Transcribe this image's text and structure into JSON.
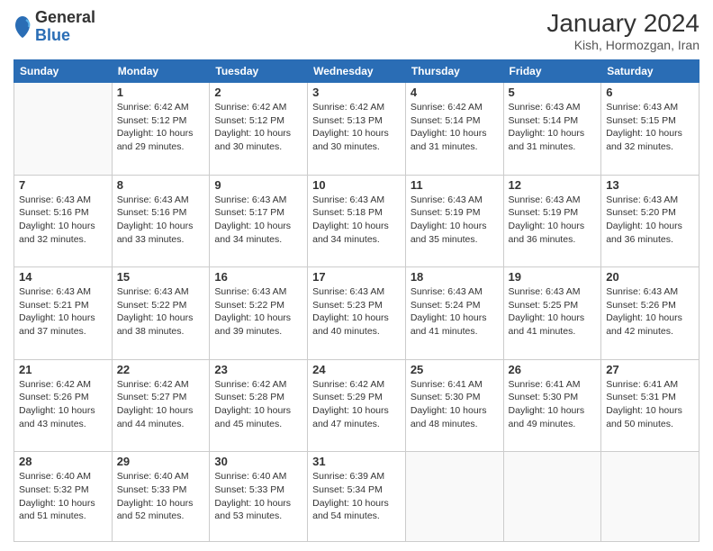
{
  "header": {
    "logo": {
      "general": "General",
      "blue": "Blue"
    },
    "title": "January 2024",
    "location": "Kish, Hormozgan, Iran"
  },
  "days_of_week": [
    "Sunday",
    "Monday",
    "Tuesday",
    "Wednesday",
    "Thursday",
    "Friday",
    "Saturday"
  ],
  "weeks": [
    [
      {
        "day": "",
        "info": ""
      },
      {
        "day": "1",
        "info": "Sunrise: 6:42 AM\nSunset: 5:12 PM\nDaylight: 10 hours and 29 minutes."
      },
      {
        "day": "2",
        "info": "Sunrise: 6:42 AM\nSunset: 5:12 PM\nDaylight: 10 hours and 30 minutes."
      },
      {
        "day": "3",
        "info": "Sunrise: 6:42 AM\nSunset: 5:13 PM\nDaylight: 10 hours and 30 minutes."
      },
      {
        "day": "4",
        "info": "Sunrise: 6:42 AM\nSunset: 5:14 PM\nDaylight: 10 hours and 31 minutes."
      },
      {
        "day": "5",
        "info": "Sunrise: 6:43 AM\nSunset: 5:14 PM\nDaylight: 10 hours and 31 minutes."
      },
      {
        "day": "6",
        "info": "Sunrise: 6:43 AM\nSunset: 5:15 PM\nDaylight: 10 hours and 32 minutes."
      }
    ],
    [
      {
        "day": "7",
        "info": "Sunrise: 6:43 AM\nSunset: 5:16 PM\nDaylight: 10 hours and 32 minutes."
      },
      {
        "day": "8",
        "info": "Sunrise: 6:43 AM\nSunset: 5:16 PM\nDaylight: 10 hours and 33 minutes."
      },
      {
        "day": "9",
        "info": "Sunrise: 6:43 AM\nSunset: 5:17 PM\nDaylight: 10 hours and 34 minutes."
      },
      {
        "day": "10",
        "info": "Sunrise: 6:43 AM\nSunset: 5:18 PM\nDaylight: 10 hours and 34 minutes."
      },
      {
        "day": "11",
        "info": "Sunrise: 6:43 AM\nSunset: 5:19 PM\nDaylight: 10 hours and 35 minutes."
      },
      {
        "day": "12",
        "info": "Sunrise: 6:43 AM\nSunset: 5:19 PM\nDaylight: 10 hours and 36 minutes."
      },
      {
        "day": "13",
        "info": "Sunrise: 6:43 AM\nSunset: 5:20 PM\nDaylight: 10 hours and 36 minutes."
      }
    ],
    [
      {
        "day": "14",
        "info": "Sunrise: 6:43 AM\nSunset: 5:21 PM\nDaylight: 10 hours and 37 minutes."
      },
      {
        "day": "15",
        "info": "Sunrise: 6:43 AM\nSunset: 5:22 PM\nDaylight: 10 hours and 38 minutes."
      },
      {
        "day": "16",
        "info": "Sunrise: 6:43 AM\nSunset: 5:22 PM\nDaylight: 10 hours and 39 minutes."
      },
      {
        "day": "17",
        "info": "Sunrise: 6:43 AM\nSunset: 5:23 PM\nDaylight: 10 hours and 40 minutes."
      },
      {
        "day": "18",
        "info": "Sunrise: 6:43 AM\nSunset: 5:24 PM\nDaylight: 10 hours and 41 minutes."
      },
      {
        "day": "19",
        "info": "Sunrise: 6:43 AM\nSunset: 5:25 PM\nDaylight: 10 hours and 41 minutes."
      },
      {
        "day": "20",
        "info": "Sunrise: 6:43 AM\nSunset: 5:26 PM\nDaylight: 10 hours and 42 minutes."
      }
    ],
    [
      {
        "day": "21",
        "info": "Sunrise: 6:42 AM\nSunset: 5:26 PM\nDaylight: 10 hours and 43 minutes."
      },
      {
        "day": "22",
        "info": "Sunrise: 6:42 AM\nSunset: 5:27 PM\nDaylight: 10 hours and 44 minutes."
      },
      {
        "day": "23",
        "info": "Sunrise: 6:42 AM\nSunset: 5:28 PM\nDaylight: 10 hours and 45 minutes."
      },
      {
        "day": "24",
        "info": "Sunrise: 6:42 AM\nSunset: 5:29 PM\nDaylight: 10 hours and 47 minutes."
      },
      {
        "day": "25",
        "info": "Sunrise: 6:41 AM\nSunset: 5:30 PM\nDaylight: 10 hours and 48 minutes."
      },
      {
        "day": "26",
        "info": "Sunrise: 6:41 AM\nSunset: 5:30 PM\nDaylight: 10 hours and 49 minutes."
      },
      {
        "day": "27",
        "info": "Sunrise: 6:41 AM\nSunset: 5:31 PM\nDaylight: 10 hours and 50 minutes."
      }
    ],
    [
      {
        "day": "28",
        "info": "Sunrise: 6:40 AM\nSunset: 5:32 PM\nDaylight: 10 hours and 51 minutes."
      },
      {
        "day": "29",
        "info": "Sunrise: 6:40 AM\nSunset: 5:33 PM\nDaylight: 10 hours and 52 minutes."
      },
      {
        "day": "30",
        "info": "Sunrise: 6:40 AM\nSunset: 5:33 PM\nDaylight: 10 hours and 53 minutes."
      },
      {
        "day": "31",
        "info": "Sunrise: 6:39 AM\nSunset: 5:34 PM\nDaylight: 10 hours and 54 minutes."
      },
      {
        "day": "",
        "info": ""
      },
      {
        "day": "",
        "info": ""
      },
      {
        "day": "",
        "info": ""
      }
    ]
  ]
}
